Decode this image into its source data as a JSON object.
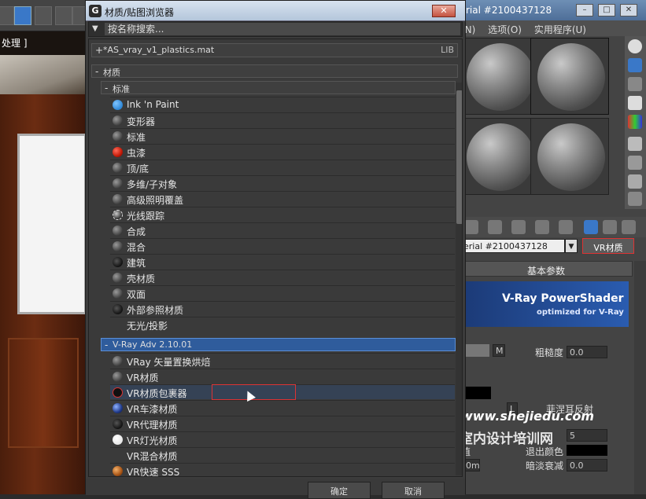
{
  "viewport": {
    "corner_label": "处理 ]"
  },
  "material_editor": {
    "title": "rial #2100437128",
    "menu": [
      "(N)",
      "选项(O)",
      "实用程序(U)"
    ],
    "material_name": "erial #2100437128",
    "material_type": "VR材质",
    "rollout_basic": "基本参数",
    "banner_title": "V-Ray PowerShader",
    "banner_subtitle": "optimized for V-Ray",
    "button_m": "M",
    "label_roughness": "粗糙度",
    "value_roughness": "0.0",
    "button_l": "L",
    "label_fresnel": "菲涅耳反射",
    "value_subdivs": "5",
    "label_value": "值",
    "label_exit_color": "退出颜色",
    "label_dim_falloff": "暗淡衰减",
    "value_dim_falloff": "0.0",
    "value_zero_m": "0m",
    "watermark_url": "www.shejiedu.com",
    "watermark_cn": "室内设计培训网"
  },
  "browser": {
    "app_icon": "G",
    "title": "材质/贴图浏览器",
    "search_placeholder": "按名称搜索...",
    "library": {
      "toggle": "+",
      "name": "*AS_vray_v1_plastics.mat",
      "tag": "LIB"
    },
    "group_materials": {
      "toggle": "-",
      "label": "材质"
    },
    "group_standard": {
      "toggle": "-",
      "label": "标准"
    },
    "standard_items": [
      {
        "label": "Ink 'n Paint",
        "icon": "ball-blue"
      },
      {
        "label": "变形器",
        "icon": "ball-grey"
      },
      {
        "label": "标准",
        "icon": "ball-grey"
      },
      {
        "label": "虫漆",
        "icon": "ball-red"
      },
      {
        "label": "顶/底",
        "icon": "ball-grey"
      },
      {
        "label": "多维/子对象",
        "icon": "ball-grey"
      },
      {
        "label": "高级照明覆盖",
        "icon": "ball-grey"
      },
      {
        "label": "光线跟踪",
        "icon": "ball-raytrace"
      },
      {
        "label": "合成",
        "icon": "ball-grey"
      },
      {
        "label": "混合",
        "icon": "ball-grey"
      },
      {
        "label": "建筑",
        "icon": "ball-black"
      },
      {
        "label": "壳材质",
        "icon": "ball-grey"
      },
      {
        "label": "双面",
        "icon": "ball-grey"
      },
      {
        "label": "外部参照材质",
        "icon": "ball-black"
      },
      {
        "label": "无光/投影",
        "icon": "none"
      }
    ],
    "group_vray": {
      "toggle": "-",
      "label": "V-Ray Adv 2.10.01"
    },
    "vray_items": [
      {
        "label": "VRay 矢量置换烘焙",
        "icon": "ball-grey"
      },
      {
        "label": "VR材质",
        "icon": "ball-grey"
      },
      {
        "label": "VR材质包裹器",
        "icon": "ball-wrap"
      },
      {
        "label": "VR车漆材质",
        "icon": "ball-carpaint"
      },
      {
        "label": "VR代理材质",
        "icon": "ball-black"
      },
      {
        "label": "VR灯光材质",
        "icon": "ball-white"
      },
      {
        "label": "VR混合材质",
        "icon": "none"
      },
      {
        "label": "VR快速 SSS",
        "icon": "ball-orange"
      }
    ],
    "ok_label": "确定",
    "cancel_label": "取消",
    "close_glyph": "✕"
  }
}
